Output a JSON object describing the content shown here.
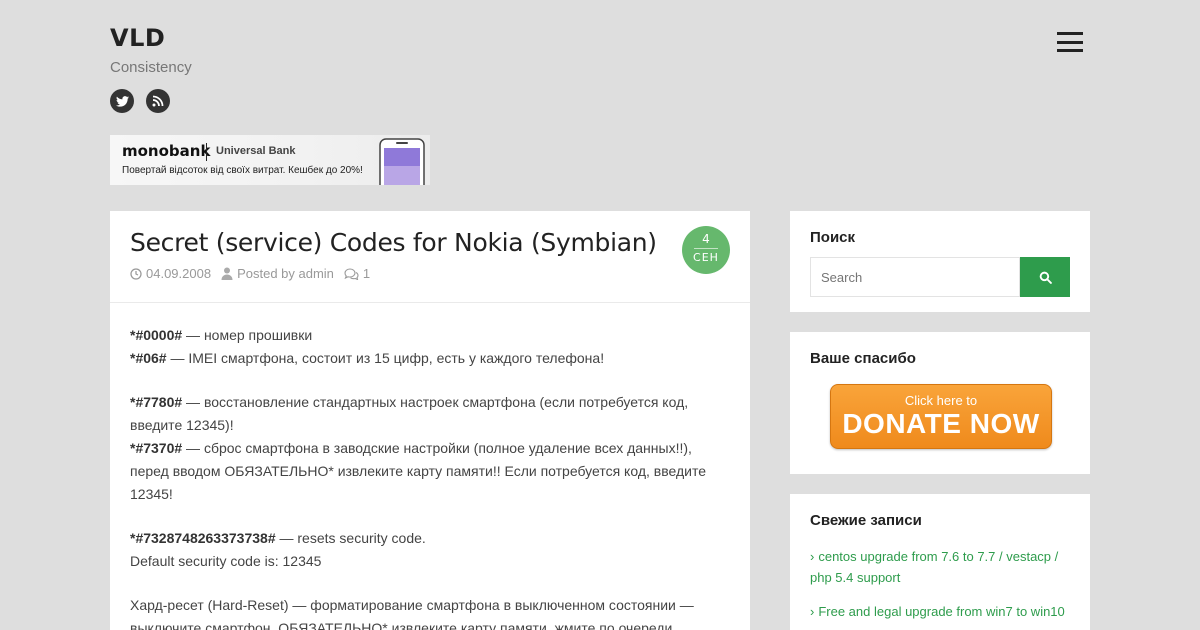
{
  "site": {
    "title": "VLD",
    "tagline": "Consistency"
  },
  "social": [
    {
      "icon": "twitter-icon"
    },
    {
      "icon": "rss-icon"
    }
  ],
  "banner": {
    "brand": "monobank",
    "subtitle": "Universal Bank",
    "tagline": "Повертай відсоток від своїх витрат. Кешбек до 20%!"
  },
  "post": {
    "title": "Secret (service) Codes for Nokia (Symbian)",
    "date": "04.09.2008",
    "author": "Posted by admin",
    "comments": "1",
    "badge_day": "4",
    "badge_month": "СЕН",
    "p1_code1": "*#0000#",
    "p1_text1": " — номер прошивки",
    "p1_code2": "*#06#",
    "p1_text2": " — IMEI смартфона, состоит из 15 цифр, есть у каждого телефона!",
    "p2_code1": "*#7780#",
    "p2_text1": " — восстановление стандартных настроек смартфона (если потребуется код, введите 12345)!",
    "p2_code2": "*#7370#",
    "p2_text2": " — сброс смартфона в заводские настройки (полное удаление всех данных!!), перед вводом ОБЯЗАТЕЛЬНО* извлеките карту памяти!! Если потребуется код, введите 12345!",
    "p3_code1": "*#7328748263373738#",
    "p3_text1": " — resets security code.",
    "p3_text2": "Default security code is: 12345",
    "p4_text": "Хард-ресет (Hard-Reset) — форматирование смартфона в выключенном состоянии — выключите смартфон, ОБЯЗАТЕЛЬНО* извлеките карту памяти, жмите по очереди"
  },
  "search_widget": {
    "title": "Поиск",
    "placeholder": "Search"
  },
  "donate_widget": {
    "title": "Ваше спасибо",
    "small": "Click here to",
    "big": "DONATE NOW"
  },
  "recent_widget": {
    "title": "Свежие записи",
    "items": [
      "centos upgrade from 7.6 to 7.7 / vestacp / php 5.4 support",
      "Free and legal upgrade from win7 to win10"
    ]
  },
  "colors": {
    "accent": "#2e9c4c",
    "badge": "#66b86d",
    "donate": "#f39a2c"
  }
}
